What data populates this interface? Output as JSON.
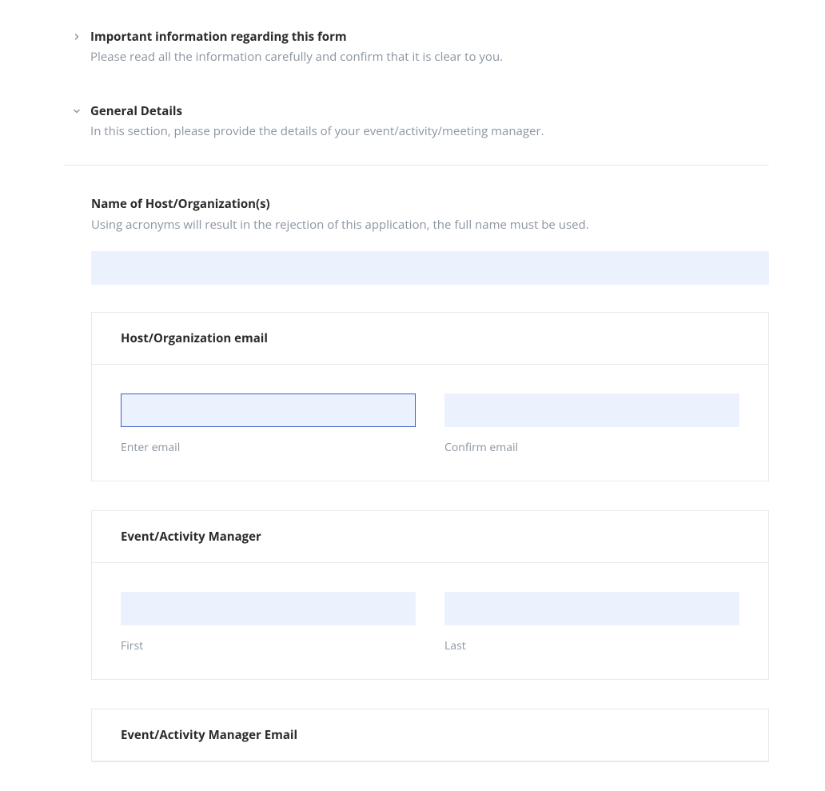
{
  "sections": {
    "important": {
      "title": "Important information regarding this form",
      "desc": "Please read all the information carefully and confirm that it is clear to you."
    },
    "general": {
      "title": "General Details",
      "desc": "In this section, please provide the details of your event/activity/meeting manager."
    }
  },
  "host": {
    "title": "Name of Host/Organization(s)",
    "desc": "Using acronyms will result in the rejection of this application, the full name must be used.",
    "value": ""
  },
  "hostEmail": {
    "title": "Host/Organization email",
    "enter": {
      "value": "",
      "label": "Enter email"
    },
    "confirm": {
      "value": "",
      "label": "Confirm email"
    }
  },
  "manager": {
    "title": "Event/Activity Manager",
    "first": {
      "value": "",
      "label": "First"
    },
    "last": {
      "value": "",
      "label": "Last"
    }
  },
  "managerEmail": {
    "title": "Event/Activity Manager Email"
  }
}
